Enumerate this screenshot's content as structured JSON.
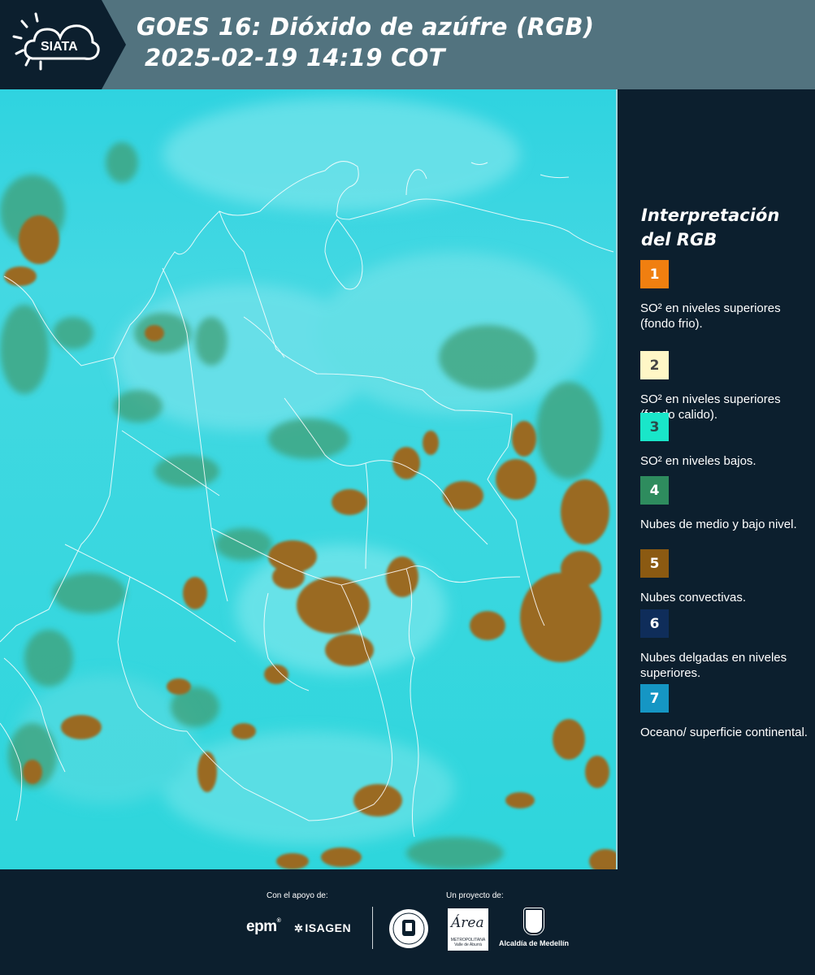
{
  "header": {
    "logo_text": "SIATA",
    "title_line1": "GOES 16: Dióxido de azúfre (RGB)",
    "title_line2": "2025-02-19 14:19 COT"
  },
  "legend": {
    "title": "Interpretación del RGB",
    "items": [
      {
        "number": "1",
        "color": "#f07f10",
        "text_color": "#ffffff",
        "label": "SO² en niveles superiores (fondo frio)."
      },
      {
        "number": "2",
        "color": "#fff7c6",
        "text_color": "#444444",
        "label": "SO² en niveles superiores (fondo calido)."
      },
      {
        "number": "3",
        "color": "#19e6c9",
        "text_color": "#2a4a4a",
        "label": "SO² en niveles bajos."
      },
      {
        "number": "4",
        "color": "#2e8c5e",
        "text_color": "#ffffff",
        "label": "Nubes de medio y bajo nivel."
      },
      {
        "number": "5",
        "color": "#8b5a12",
        "text_color": "#ffffff",
        "label": "Nubes convectivas."
      },
      {
        "number": "6",
        "color": "#0f2d5a",
        "text_color": "#ffffff",
        "label": "Nubes delgadas en niveles superiores."
      },
      {
        "number": "7",
        "color": "#1596c4",
        "text_color": "#ffffff",
        "label": "Oceano/ superficie continental."
      }
    ]
  },
  "footer": {
    "support_label": "Con el apoyo de:",
    "project_label": "Un proyecto de:",
    "epm": "epm",
    "isagen": "ISAGEN",
    "area_word": "Área",
    "area_sub": "METROPOLITANA Valle de Aburrá",
    "alcaldia": "Alcaldía de Medellín"
  }
}
